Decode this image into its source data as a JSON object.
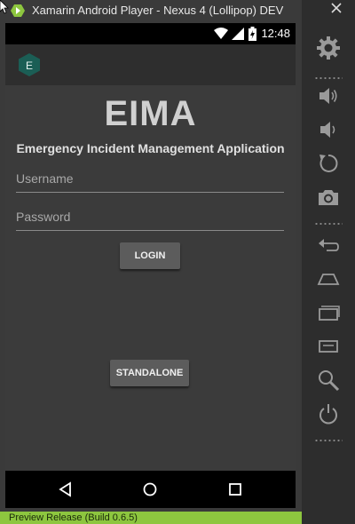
{
  "window": {
    "title": "Xamarin Android Player - Nexus 4 (Lollipop) DEV"
  },
  "statusbar": {
    "time": "12:48"
  },
  "app": {
    "badge_letter": "E",
    "heading": "EIMA",
    "subtitle": "Emergency Incident Management Application"
  },
  "form": {
    "username_placeholder": "Username",
    "password_placeholder": "Password",
    "username_value": "",
    "password_value": "",
    "login_label": "LOGIN",
    "standalone_label": "STANDALONE"
  },
  "footer": {
    "release": "Preview Release",
    "build": "(Build 0.6.5)"
  },
  "colors": {
    "accent_green": "#8dc63f",
    "badge_teal": "#1b5e55"
  },
  "side_controls": [
    "settings-icon",
    "volume-up-icon",
    "volume-down-icon",
    "rotate-icon",
    "camera-icon",
    "back-icon",
    "home-icon",
    "recents-icon",
    "menu-icon",
    "search-icon",
    "power-icon"
  ]
}
